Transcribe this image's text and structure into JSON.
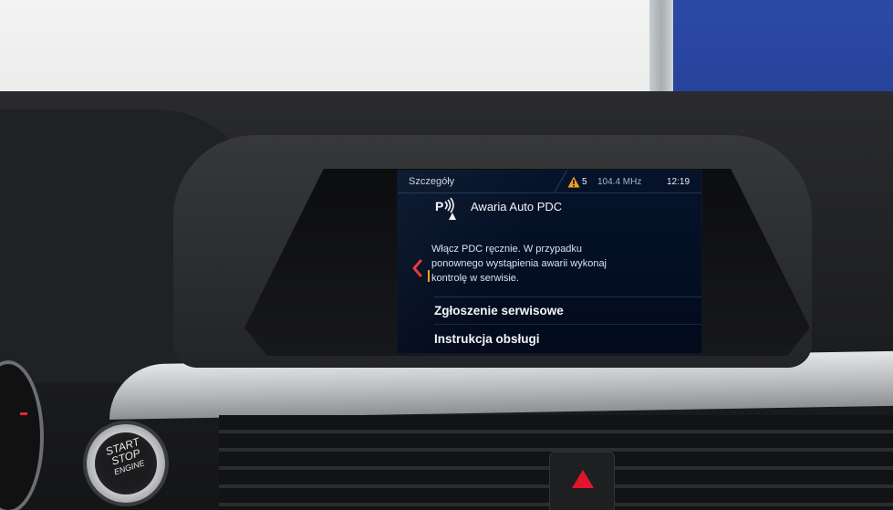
{
  "display": {
    "status_bar": {
      "title": "Szczegóły",
      "warning_count": "5",
      "radio_frequency": "104.4 MHz",
      "time": "12:19"
    },
    "message": {
      "icon": "pdc-sensor-icon",
      "title": "Awaria Auto PDC",
      "body_lines": [
        "Włącz PDC ręcznie. W przypadku",
        "ponownego wystąpienia awarii wykonaj",
        "kontrolę w serwisie."
      ]
    },
    "menu": [
      {
        "label": "Zgłoszenie serwisowe"
      },
      {
        "label": "Instrukcja obsługi"
      }
    ],
    "colors": {
      "accent_warning": "#f0a21c",
      "back_chevron": "#e8333b",
      "screen_background": "#041025"
    }
  },
  "start_stop_button": {
    "lines": [
      "START",
      "STOP",
      "ENGINE"
    ]
  }
}
